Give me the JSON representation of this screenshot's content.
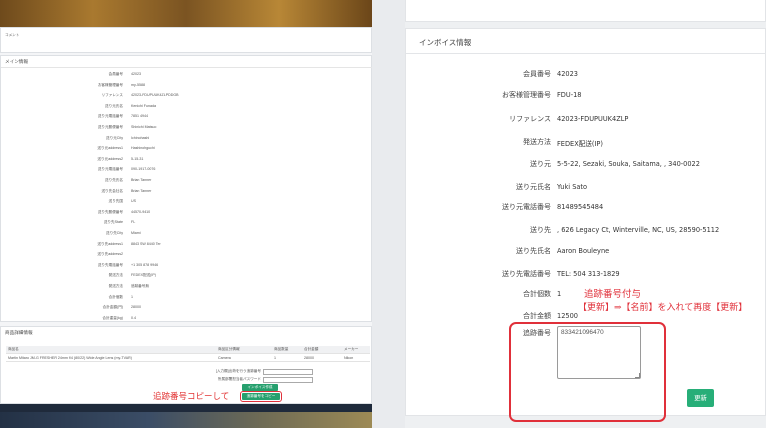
{
  "left": {
    "comment_label": "コメント",
    "main_section": "メイン情報",
    "rows": [
      {
        "label": "会員番号",
        "value": "42023"
      },
      {
        "label": "お客様管理番号",
        "value": "my-5588"
      },
      {
        "label": "リファレンス",
        "value": "42023-FDUPUUK4ZLPDDGB"
      },
      {
        "label": "送り元氏名",
        "value": "Kenichi Funada"
      },
      {
        "label": "送り元電話番号",
        "value": "7851 4944"
      },
      {
        "label": "送り元郵便番号",
        "value": "Shinichi Matsuo"
      },
      {
        "label": "送り元City",
        "value": "Ichinohashi"
      },
      {
        "label": "送り元address1",
        "value": "Hashinohguchi"
      },
      {
        "label": "送り元address2",
        "value": "5-15-31"
      },
      {
        "label": "送り元電話番号",
        "value": "090-1917-0076"
      },
      {
        "label": "送り先氏名",
        "value": "Brian Tanner"
      },
      {
        "label": "送り先会社名",
        "value": "Brian Tanner"
      },
      {
        "label": "送り先国",
        "value": "US"
      },
      {
        "label": "送り先郵便番号",
        "value": "44570-9410"
      },
      {
        "label": "送り先State",
        "value": "FL"
      },
      {
        "label": "送り先City",
        "value": "Miami"
      },
      {
        "label": "送り先address1",
        "value": "8843 SW 8440 Ter"
      },
      {
        "label": "送り先address2",
        "value": ""
      },
      {
        "label": "送り先電話番号",
        "value": "+1 305 878 9946"
      },
      {
        "label": "発送方法",
        "value": "FEDEX配送(IP)"
      },
      {
        "label": "発送方法",
        "value": "追跡番号無"
      },
      {
        "label": "合計個数",
        "value": "1"
      },
      {
        "label": "合計金額(円)",
        "value": "28000"
      },
      {
        "label": "合計重量(kg)",
        "value": "0.4"
      }
    ],
    "detail_section": "商品詳細情報",
    "table": {
      "headers": [
        "商品名",
        "商品区分情報",
        "商品数量",
        "合計金額",
        "メーカー"
      ],
      "rows": [
        [
          "Martin Mitaro JM-G FRESHER 24mm f/4 (80/22) Wide Angle Lens (my-TVAR)",
          "Camera",
          "1",
          "28000",
          "Nikon"
        ]
      ]
    },
    "form_label1": "[入力欄]出荷を行う追跡番号",
    "form_label2": "所属部署担当者パスワード",
    "invoice_btn": "インボイス作成",
    "copy_btn": "追跡番号をコピー",
    "annotation": "追跡番号コピーして"
  },
  "right": {
    "panel_title": "インボイス情報",
    "fields": [
      {
        "label": "会員番号",
        "value": "42023"
      },
      {
        "label": "お客様管理番号",
        "value": "FDU-18"
      },
      {
        "label": "リファレンス",
        "value": "42023-FDUPUUK4ZLP"
      },
      {
        "label": "発送方法",
        "value": "FEDEX配送(IP)"
      },
      {
        "label": "送り元",
        "value": "5-5-22, Sezaki, Souka, Saitama, , 340-0022"
      },
      {
        "label": "送り元氏名",
        "value": "Yuki Sato"
      },
      {
        "label": "送り元電話番号",
        "value": "81489545484"
      },
      {
        "label": "送り先",
        "value": ", 626 Legacy Ct, Winterville, NC, US, 28590-5112"
      },
      {
        "label": "送り先氏名",
        "value": "Aaron Bouleyne"
      },
      {
        "label": "送り先電話番号",
        "value": "TEL: 504 313-1829"
      },
      {
        "label": "合計個数",
        "value": "1"
      },
      {
        "label": "合計金額",
        "value": "12500"
      }
    ],
    "tracking_label": "追跡番号",
    "tracking_value": "833421096470",
    "update_btn": "更新",
    "annotation_line1": "追跡番号付与",
    "annotation_line2": "【更新】⇒【名前】を入れて再度【更新】"
  }
}
